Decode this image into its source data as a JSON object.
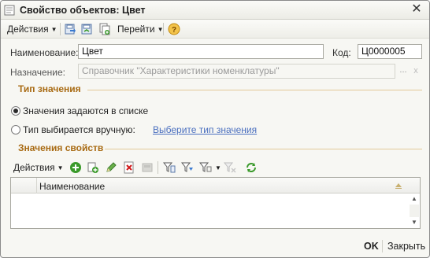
{
  "window": {
    "title": "Свойство объектов: Цвет"
  },
  "toolbar": {
    "actions_label": "Действия",
    "goto_label": "Перейти",
    "help_label": "?"
  },
  "form": {
    "name_label": "Наименование:",
    "name_value": "Цвет",
    "code_label": "Код:",
    "code_value": "Ц0000005",
    "purpose_label": "Назначение:",
    "purpose_value": "Справочник \"Характеристики номенклатуры\"",
    "purpose_dots": "...",
    "purpose_clear": "x"
  },
  "value_type": {
    "section_title": "Тип значения",
    "option_list": "Значения задаются в списке",
    "option_manual": "Тип выбирается вручную:",
    "select_link": "Выберите тип значения"
  },
  "values": {
    "section_title": "Значения свойств",
    "actions_label": "Действия",
    "column_name": "Наименование"
  },
  "footer": {
    "ok_label": "OK",
    "close_label": "Закрыть"
  },
  "colors": {
    "accent": "#a86a12",
    "link": "#4a6fbf",
    "add_green": "#3a9a2a",
    "delete_red": "#d01818"
  }
}
